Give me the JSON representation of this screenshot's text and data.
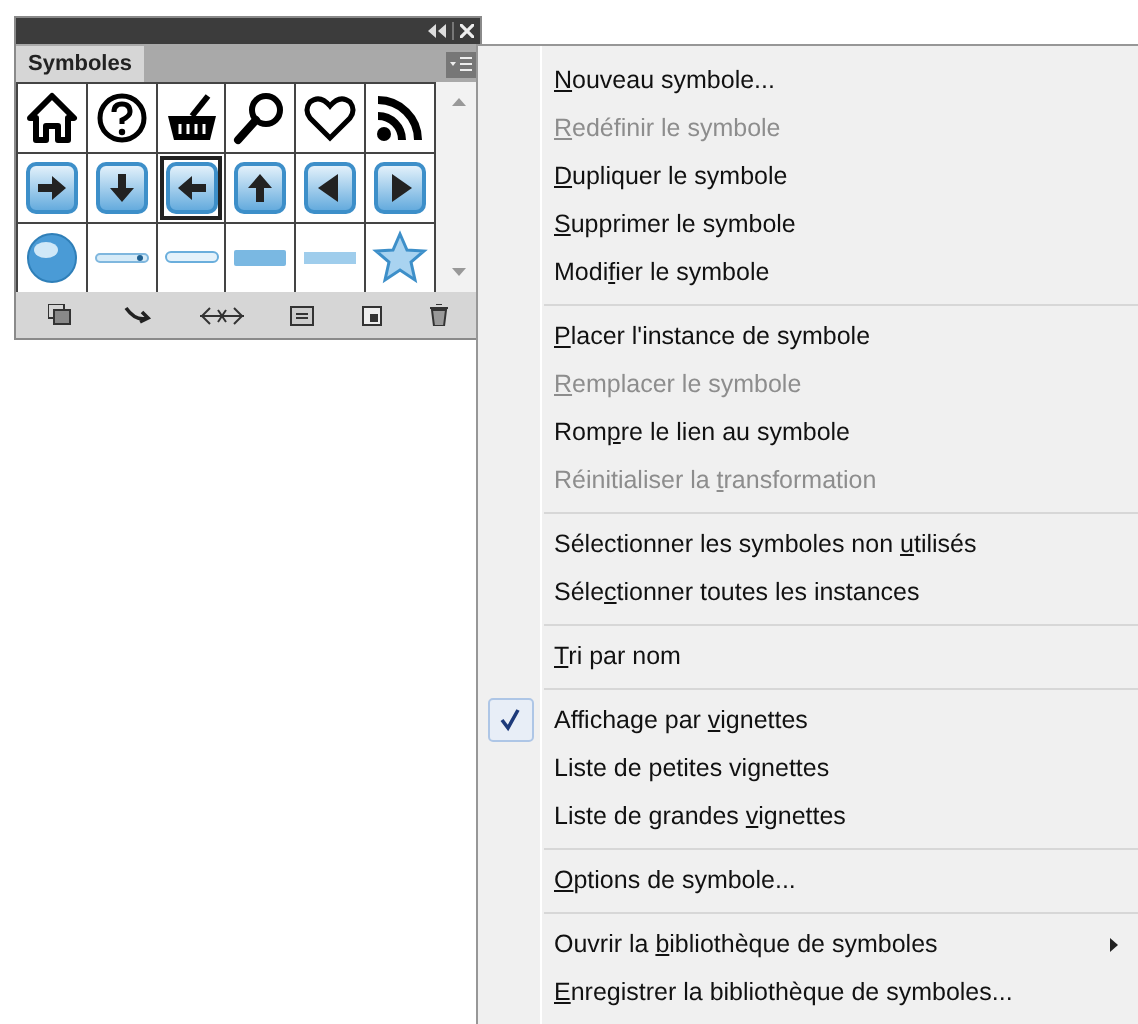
{
  "panel": {
    "tab": {
      "label": "Symboles",
      "selected": true
    },
    "symbols": [
      {
        "kind": "home",
        "selected": false
      },
      {
        "kind": "help",
        "selected": false
      },
      {
        "kind": "basket",
        "selected": false
      },
      {
        "kind": "search",
        "selected": false
      },
      {
        "kind": "heart",
        "selected": false
      },
      {
        "kind": "rss",
        "selected": false
      },
      {
        "kind": "arrow-right",
        "selected": false
      },
      {
        "kind": "arrow-down",
        "selected": false
      },
      {
        "kind": "arrow-left",
        "selected": true
      },
      {
        "kind": "arrow-up",
        "selected": false
      },
      {
        "kind": "triangle-left",
        "selected": false
      },
      {
        "kind": "triangle-right",
        "selected": false
      },
      {
        "kind": "globe",
        "selected": false
      },
      {
        "kind": "bar-dot",
        "selected": false
      },
      {
        "kind": "bar-thin",
        "selected": false
      },
      {
        "kind": "bar-thick",
        "selected": false
      },
      {
        "kind": "bar-medium",
        "selected": false
      },
      {
        "kind": "star",
        "selected": false
      }
    ]
  },
  "menu": {
    "groups": [
      [
        {
          "accel": "N",
          "after": "ouveau symbole...",
          "disabled": false,
          "checked": false
        },
        {
          "accel": "R",
          "after": "edéfinir le symbole",
          "disabled": true,
          "checked": false
        },
        {
          "accel": "D",
          "after": "upliquer le symbole",
          "disabled": false,
          "checked": false
        },
        {
          "accel": "S",
          "after": "upprimer le symbole",
          "disabled": false,
          "checked": false
        },
        {
          "before": "Modi",
          "accel": "f",
          "after": "ier le symbole",
          "disabled": false,
          "checked": false
        }
      ],
      [
        {
          "accel": "P",
          "after": "lacer l'instance de symbole",
          "disabled": false,
          "checked": false
        },
        {
          "accel": "R",
          "after": "emplacer le symbole",
          "disabled": true,
          "checked": false
        },
        {
          "before": "Rom",
          "accel": "p",
          "after": "re le lien au symbole",
          "disabled": false,
          "checked": false
        },
        {
          "before": "Réinitialiser la ",
          "accel": "t",
          "after": "ransformation",
          "disabled": true,
          "checked": false
        }
      ],
      [
        {
          "before": "Sélectionner les symboles non ",
          "accel": "u",
          "after": "tilisés",
          "disabled": false,
          "checked": false
        },
        {
          "before": "Séle",
          "accel": "c",
          "after": "tionner toutes les instances",
          "disabled": false,
          "checked": false
        }
      ],
      [
        {
          "accel": "T",
          "after": "ri par nom",
          "disabled": false,
          "checked": false
        }
      ],
      [
        {
          "before": "Affichage par ",
          "accel": "v",
          "after": "ignettes",
          "disabled": false,
          "checked": true
        },
        {
          "before": "Liste de petites vignettes",
          "disabled": false,
          "checked": false
        },
        {
          "before": "Liste de grandes ",
          "accel": "v",
          "after": "ignettes",
          "disabled": false,
          "checked": false
        }
      ],
      [
        {
          "accel": "O",
          "after": "ptions de symbole...",
          "disabled": false,
          "checked": false
        }
      ],
      [
        {
          "before": "Ouvrir la ",
          "accel": "b",
          "after": "ibliothèque de symboles",
          "disabled": false,
          "checked": false,
          "submenu": true
        },
        {
          "accel": "E",
          "after": "nregistrer la bibliothèque de symboles...",
          "disabled": false,
          "checked": false
        }
      ]
    ]
  }
}
